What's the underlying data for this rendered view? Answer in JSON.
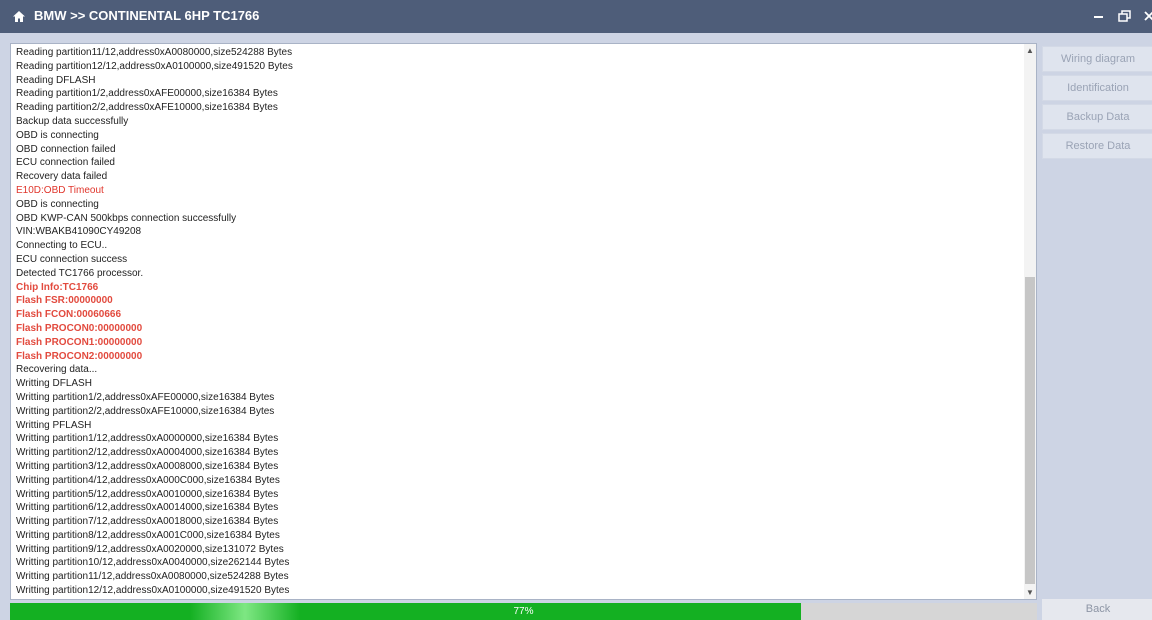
{
  "window": {
    "title": "BMW >> CONTINENTAL 6HP TC1766",
    "controls": {
      "minimize": "–",
      "restore": "⧉",
      "close": "✕"
    }
  },
  "log": {
    "lines": [
      {
        "text": "Reading partition11/12,address0xA0080000,size524288 Bytes",
        "style": "normal"
      },
      {
        "text": "Reading partition12/12,address0xA0100000,size491520 Bytes",
        "style": "normal"
      },
      {
        "text": "Reading DFLASH",
        "style": "normal"
      },
      {
        "text": "Reading partition1/2,address0xAFE00000,size16384 Bytes",
        "style": "normal"
      },
      {
        "text": "Reading partition2/2,address0xAFE10000,size16384 Bytes",
        "style": "normal"
      },
      {
        "text": "Backup data successfully",
        "style": "normal"
      },
      {
        "text": "OBD is connecting",
        "style": "normal"
      },
      {
        "text": "OBD connection failed",
        "style": "normal"
      },
      {
        "text": "ECU connection failed",
        "style": "normal"
      },
      {
        "text": "Recovery data failed",
        "style": "normal"
      },
      {
        "text": "E10D:OBD Timeout",
        "style": "red"
      },
      {
        "text": "OBD is connecting",
        "style": "normal"
      },
      {
        "text": "OBD KWP-CAN 500kbps connection successfully",
        "style": "normal"
      },
      {
        "text": "VIN:WBAKB41090CY49208",
        "style": "normal"
      },
      {
        "text": "Connecting to ECU..",
        "style": "normal"
      },
      {
        "text": "ECU connection success",
        "style": "normal"
      },
      {
        "text": "Detected TC1766 processor.",
        "style": "normal"
      },
      {
        "text": "Chip Info:TC1766",
        "style": "bold-red"
      },
      {
        "text": "Flash FSR:00000000",
        "style": "bold-red"
      },
      {
        "text": "Flash FCON:00060666",
        "style": "bold-red"
      },
      {
        "text": "Flash PROCON0:00000000",
        "style": "bold-red"
      },
      {
        "text": "Flash PROCON1:00000000",
        "style": "bold-red"
      },
      {
        "text": "Flash PROCON2:00000000",
        "style": "bold-red"
      },
      {
        "text": "Recovering data...",
        "style": "normal"
      },
      {
        "text": "Writting DFLASH",
        "style": "normal"
      },
      {
        "text": "Writting partition1/2,address0xAFE00000,size16384 Bytes",
        "style": "normal"
      },
      {
        "text": "Writting partition2/2,address0xAFE10000,size16384 Bytes",
        "style": "normal"
      },
      {
        "text": "Writting PFLASH",
        "style": "normal"
      },
      {
        "text": "Writting partition1/12,address0xA0000000,size16384 Bytes",
        "style": "normal"
      },
      {
        "text": "Writting partition2/12,address0xA0004000,size16384 Bytes",
        "style": "normal"
      },
      {
        "text": "Writting partition3/12,address0xA0008000,size16384 Bytes",
        "style": "normal"
      },
      {
        "text": "Writting partition4/12,address0xA000C000,size16384 Bytes",
        "style": "normal"
      },
      {
        "text": "Writting partition5/12,address0xA0010000,size16384 Bytes",
        "style": "normal"
      },
      {
        "text": "Writting partition6/12,address0xA0014000,size16384 Bytes",
        "style": "normal"
      },
      {
        "text": "Writting partition7/12,address0xA0018000,size16384 Bytes",
        "style": "normal"
      },
      {
        "text": "Writting partition8/12,address0xA001C000,size16384 Bytes",
        "style": "normal"
      },
      {
        "text": "Writting partition9/12,address0xA0020000,size131072 Bytes",
        "style": "normal"
      },
      {
        "text": "Writting partition10/12,address0xA0040000,size262144 Bytes",
        "style": "normal"
      },
      {
        "text": "Writting partition11/12,address0xA0080000,size524288 Bytes",
        "style": "normal"
      },
      {
        "text": "Writting partition12/12,address0xA0100000,size491520 Bytes",
        "style": "normal"
      }
    ]
  },
  "sidebar": {
    "buttons": [
      {
        "label": "Wiring diagram",
        "name": "wiring-diagram-button"
      },
      {
        "label": "Identification",
        "name": "identification-button"
      },
      {
        "label": "Backup Data",
        "name": "backup-data-button"
      },
      {
        "label": "Restore Data",
        "name": "restore-data-button"
      }
    ]
  },
  "progress": {
    "value": 0.77,
    "label": "77%"
  },
  "footer": {
    "back_label": "Back"
  },
  "colors": {
    "titlebar": "#4e5d79",
    "background": "#cdd4e4",
    "error_text": "#e0352b",
    "progress_fill": "#14b022"
  },
  "icons": [
    "home-icon",
    "minimize-icon",
    "restore-icon",
    "close-icon",
    "scroll-up-icon",
    "scroll-down-icon"
  ]
}
